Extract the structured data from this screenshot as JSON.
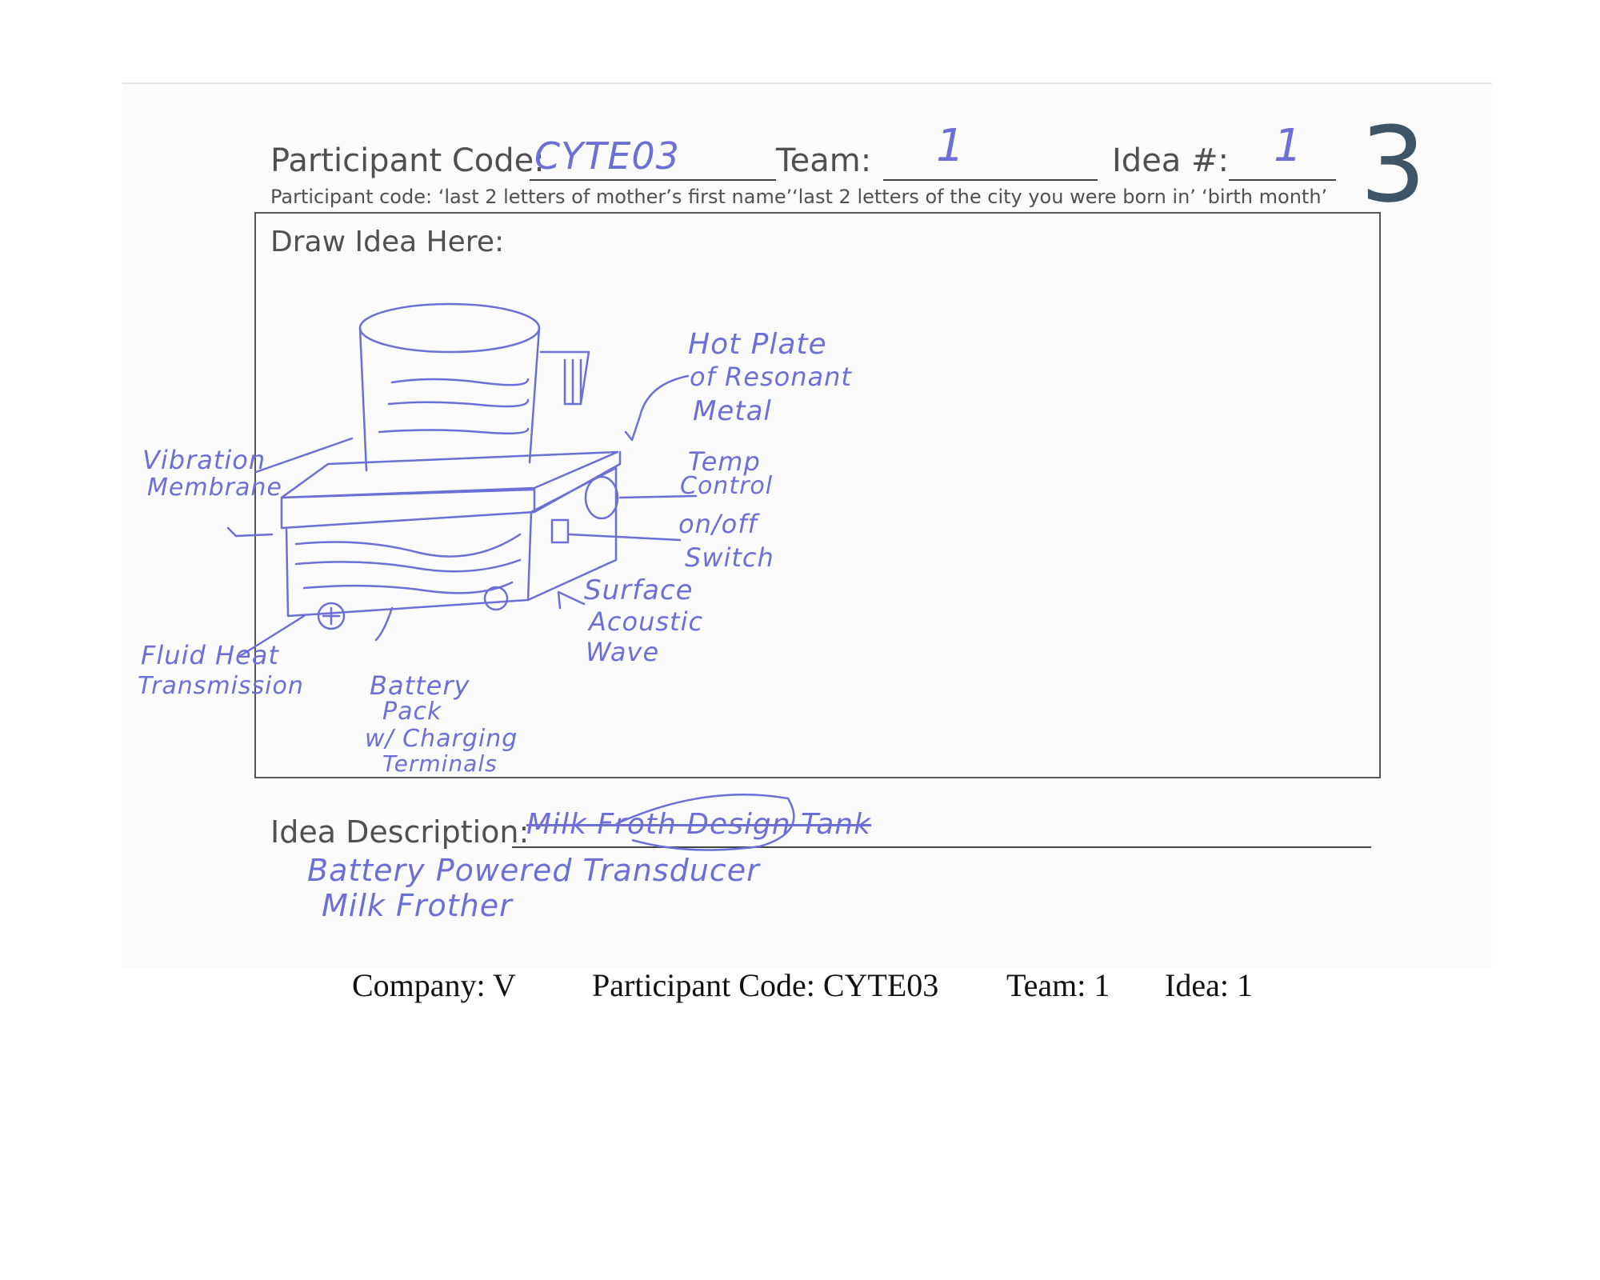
{
  "form": {
    "participant_code_label": "Participant Code:",
    "team_label": "Team:",
    "idea_label": "Idea #:",
    "participant_code_hint_1": "Participant code: ‘last 2 letters of mother’s first name’",
    "participant_code_hint_2": "‘last 2 letters of the city you were born in’",
    "participant_code_hint_3": "‘birth month’",
    "draw_label": "Draw Idea Here:",
    "description_label": "Idea Description:"
  },
  "handwritten": {
    "participant_code": "CYTE03",
    "team": "1",
    "idea_number": "1",
    "page_number": "3",
    "annotations": {
      "hot_plate": [
        "Hot Plate",
        "of Resonant",
        "Metal"
      ],
      "temp_control": [
        "Temp",
        "Control"
      ],
      "on_off": [
        "on/off",
        "Switch"
      ],
      "surface_acoustic": [
        "Surface",
        "Acoustic",
        "Wave"
      ],
      "vibration": [
        "Vibration",
        "Membrane"
      ],
      "fluid_heat": [
        "Fluid Heat",
        "Transmission"
      ],
      "battery": [
        "Battery",
        "Pack",
        "w/ Charging",
        "Terminals"
      ]
    },
    "description_crossed": "Milk Froth Design Tank",
    "description_lines": [
      "Battery Powered Transducer",
      "Milk Frother"
    ]
  },
  "footer": {
    "company": "Company: V",
    "participant_code": "Participant Code: CYTE03",
    "team": "Team: 1",
    "idea": "Idea: 1"
  }
}
